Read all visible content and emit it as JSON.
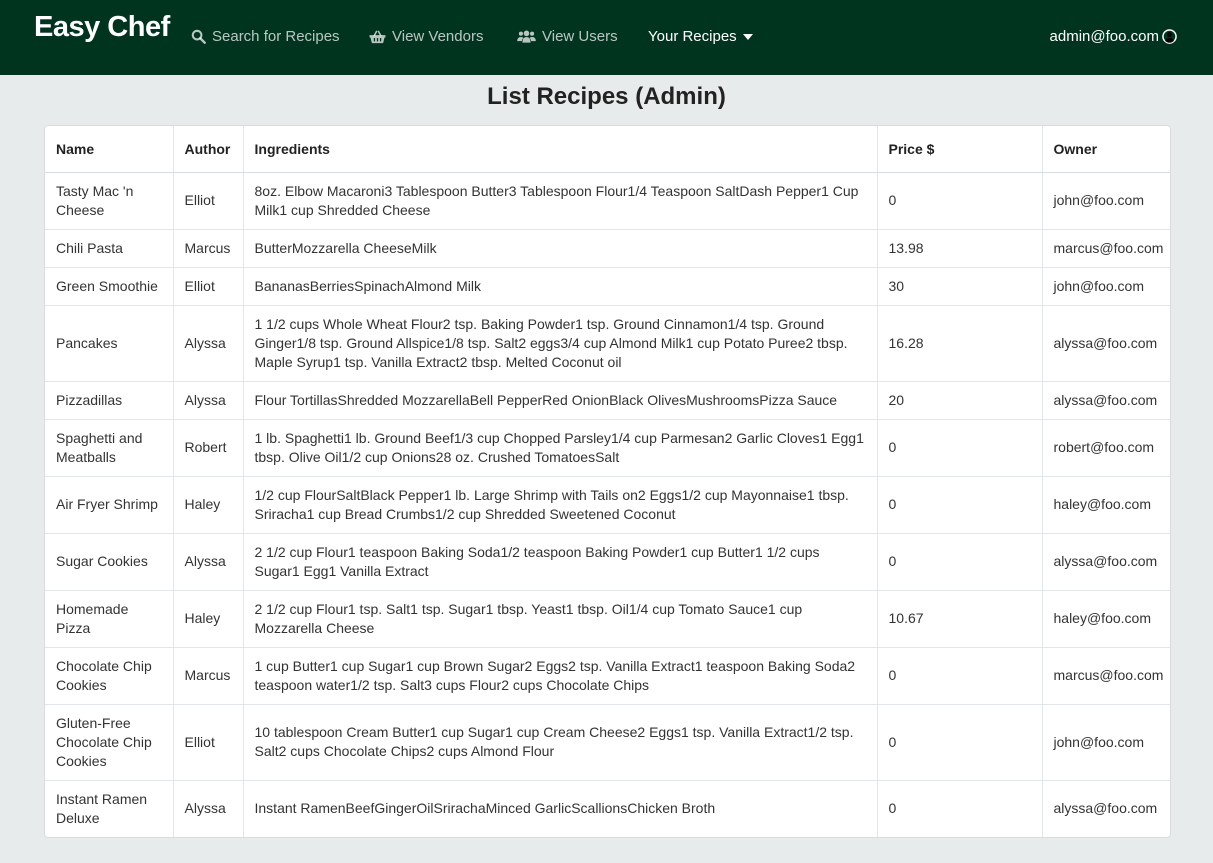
{
  "brand": "Easy Chef",
  "nav": {
    "search": "Search for Recipes",
    "vendors": "View Vendors",
    "users": "View Users",
    "recipes": "Your Recipes",
    "user": "admin@foo.com"
  },
  "title": "List Recipes (Admin)",
  "table": {
    "headers": [
      "Name",
      "Author",
      "Ingredients",
      "Price $",
      "Owner"
    ],
    "rows": [
      [
        "Tasty Mac 'n Cheese",
        "Elliot",
        "8oz. Elbow Macaroni3 Tablespoon Butter3 Tablespoon Flour1/4 Teaspoon SaltDash Pepper1 Cup Milk1 cup Shredded Cheese",
        "0",
        "john@foo.com"
      ],
      [
        "Chili Pasta",
        "Marcus",
        "ButterMozzarella CheeseMilk",
        "13.98",
        "marcus@foo.com"
      ],
      [
        "Green Smoothie",
        "Elliot",
        "BananasBerriesSpinachAlmond Milk",
        "30",
        "john@foo.com"
      ],
      [
        "Pancakes",
        "Alyssa",
        "1 1/2 cups Whole Wheat Flour2 tsp. Baking Powder1 tsp. Ground Cinnamon1/4 tsp. Ground Ginger1/8 tsp. Ground Allspice1/8 tsp. Salt2 eggs3/4 cup Almond Milk1 cup Potato Puree2 tbsp. Maple Syrup1 tsp. Vanilla Extract2 tbsp. Melted Coconut oil",
        "16.28",
        "alyssa@foo.com"
      ],
      [
        "Pizzadillas",
        "Alyssa",
        "Flour TortillasShredded MozzarellaBell PepperRed OnionBlack OlivesMushroomsPizza Sauce",
        "20",
        "alyssa@foo.com"
      ],
      [
        "Spaghetti and Meatballs",
        "Robert",
        "1 lb. Spaghetti1 lb. Ground Beef1/3 cup Chopped Parsley1/4 cup Parmesan2 Garlic Cloves1 Egg1 tbsp. Olive Oil1/2 cup Onions28 oz. Crushed TomatoesSalt",
        "0",
        "robert@foo.com"
      ],
      [
        "Air Fryer Shrimp",
        "Haley",
        "1/2 cup FlourSaltBlack Pepper1 lb. Large Shrimp with Tails on2 Eggs1/2 cup Mayonnaise1 tbsp. Sriracha1 cup Bread Crumbs1/2 cup Shredded Sweetened Coconut",
        "0",
        "haley@foo.com"
      ],
      [
        "Sugar Cookies",
        "Alyssa",
        "2 1/2 cup Flour1 teaspoon Baking Soda1/2 teaspoon Baking Powder1 cup Butter1 1/2 cups Sugar1 Egg1 Vanilla Extract",
        "0",
        "alyssa@foo.com"
      ],
      [
        "Homemade Pizza",
        "Haley",
        "2 1/2 cup Flour1 tsp. Salt1 tsp. Sugar1 tbsp. Yeast1 tbsp. Oil1/4 cup Tomato Sauce1 cup Mozzarella Cheese",
        "10.67",
        "haley@foo.com"
      ],
      [
        "Chocolate Chip Cookies",
        "Marcus",
        "1 cup Butter1 cup Sugar1 cup Brown Sugar2 Eggs2 tsp. Vanilla Extract1 teaspoon Baking Soda2 teaspoon water1/2 tsp. Salt3 cups Flour2 cups Chocolate Chips",
        "0",
        "marcus@foo.com"
      ],
      [
        "Gluten-Free Chocolate Chip Cookies",
        "Elliot",
        "10 tablespoon Cream Butter1 cup Sugar1 cup Cream Cheese2 Eggs1 tsp. Vanilla Extract1/2 tsp. Salt2 cups Chocolate Chips2 cups Almond Flour",
        "0",
        "john@foo.com"
      ],
      [
        "Instant Ramen Deluxe",
        "Alyssa",
        "Instant RamenBeefGingerOilSrirachaMinced GarlicScallionsChicken Broth",
        "0",
        "alyssa@foo.com"
      ]
    ]
  }
}
